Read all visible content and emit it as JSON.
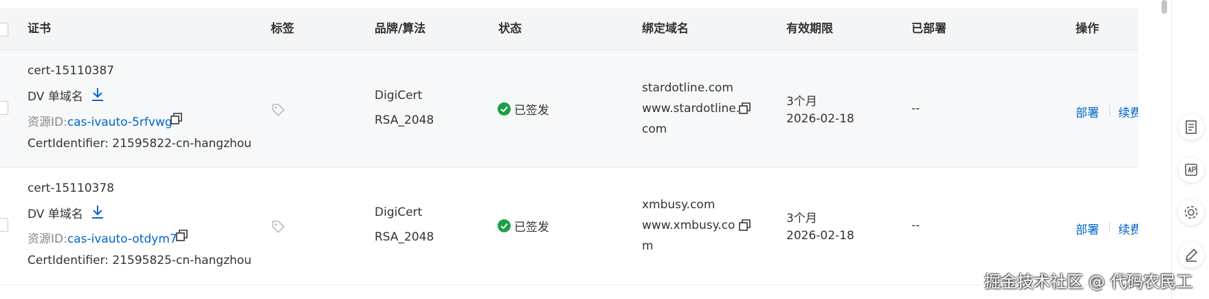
{
  "table": {
    "headers": {
      "cert": "证书",
      "tags": "标签",
      "brand": "品牌/算法",
      "status": "状态",
      "domain": "绑定域名",
      "validity": "有效期限",
      "deployed": "已部署",
      "actions": "操作"
    },
    "rows": [
      {
        "name": "cert-15110387",
        "type": "DV 单域名",
        "resource_label": "资源ID:",
        "resource_id": "cas-ivauto-5rfvwg",
        "identifier": "CertIdentifier: 21595822-cn-hangzhou",
        "brand": "DigiCert",
        "algorithm": "RSA_2048",
        "status": "已签发",
        "domain_line1": "stardotline.com",
        "domain_line2": "www.stardotline.",
        "domain_line3": "com",
        "validity_period": "3个月",
        "validity_date": "2026-02-18",
        "deployed": "--",
        "action_deploy": "部署",
        "action_renew": "续费"
      },
      {
        "name": "cert-15110378",
        "type": "DV 单域名",
        "resource_label": "资源ID:",
        "resource_id": "cas-ivauto-otdym7",
        "identifier": "CertIdentifier: 21595825-cn-hangzhou",
        "brand": "DigiCert",
        "algorithm": "RSA_2048",
        "status": "已签发",
        "domain_line1": "xmbusy.com",
        "domain_line2": "www.xmbusy.co",
        "domain_line3": "m",
        "validity_period": "3个月",
        "validity_date": "2026-02-18",
        "deployed": "--",
        "action_deploy": "部署",
        "action_renew": "续费"
      }
    ]
  },
  "watermark": "掘金技术社区 @ 代码农民工",
  "colors": {
    "link": "#0064c8",
    "status_ok": "#1e9e47",
    "header_bg": "#f3f5f7",
    "row_alt_bg": "#f6f8fa"
  },
  "icons": {
    "download": "download-icon",
    "copy": "copy-icon",
    "tag": "tag-icon",
    "status": "check-circle-icon",
    "sidebar": [
      "document-icon",
      "api-icon",
      "gear-icon",
      "edit-icon"
    ]
  }
}
